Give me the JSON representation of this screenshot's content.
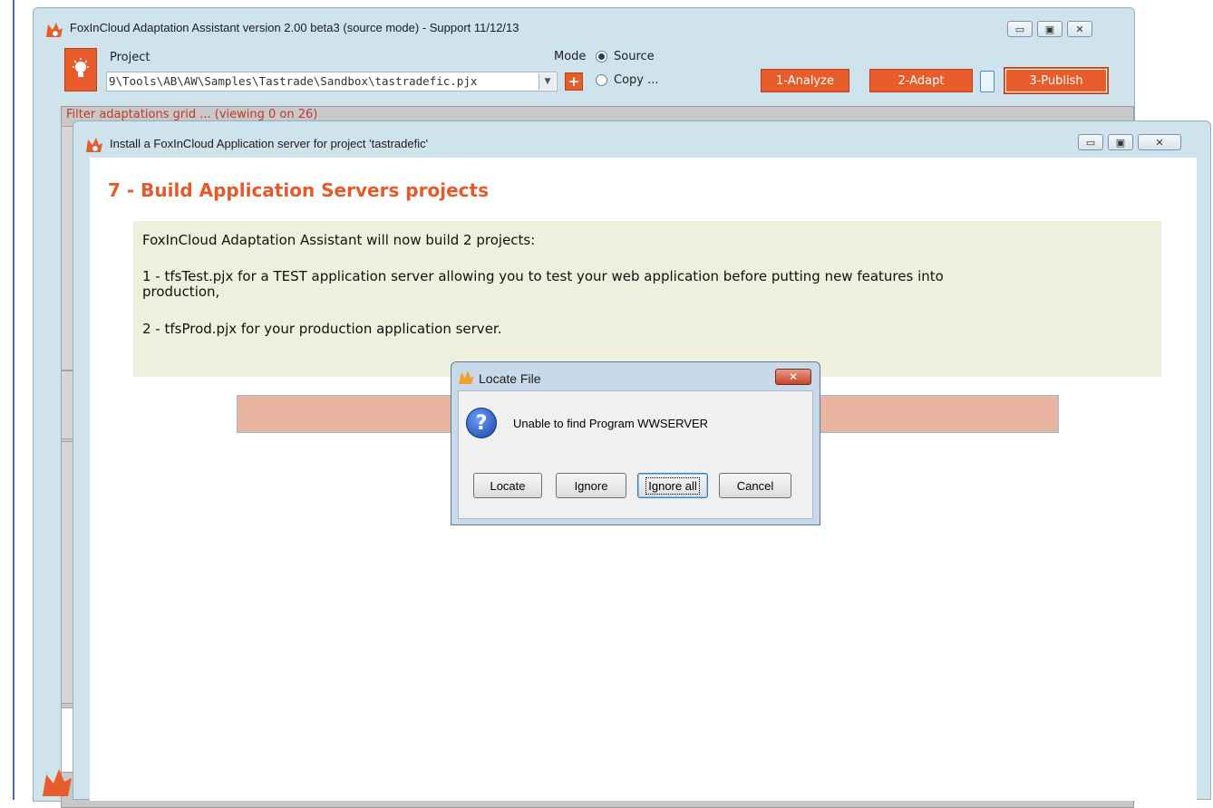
{
  "main_window": {
    "title": "FoxInCloud Adaptation Assistant version 2.00 beta3 (source mode) - Support 11/12/13",
    "project_label": "Project",
    "project_path": "9\\Tools\\AB\\AW\\Samples\\Tastrade\\Sandbox\\tastradefic.pjx",
    "mode_label": "Mode",
    "mode_source": "Source",
    "mode_copy": "Copy ...",
    "plus_label": "+",
    "analyze_button": "1-Analyze",
    "adapt_button": "2-Adapt",
    "publish_button": "3-Publish",
    "filter_text": "Filter adaptations grid ... (viewing 0 on 26)"
  },
  "install_window": {
    "title": "Install a FoxInCloud Application server for project 'tastradefic'",
    "heading": "7 - Build Application Servers projects",
    "info_line1": "FoxInCloud Adaptation Assistant will now build 2 projects:",
    "info_line2a": "1 - tfsTest.pjx for a TEST application server allowing you to test your web application before putting new features into",
    "info_line2b": "production,",
    "info_line3": "2 - tfsProd.pjx for your production application server."
  },
  "locate_dialog": {
    "title": "Locate File",
    "close_glyph": "✕",
    "question_glyph": "?",
    "message": "Unable to find Program WWSERVER",
    "buttons": {
      "locate": "Locate",
      "ignore": "Ignore",
      "ignore_all": "Ignore all",
      "cancel": "Cancel"
    }
  },
  "colors": {
    "accent_orange": "#e65c2b",
    "heading_orange": "#e8592a",
    "filter_red": "#c0392b",
    "window_frame": "#cfe3ec"
  },
  "icons": {
    "app_icon": "fox-icon",
    "bulb": "lightbulb-icon",
    "question": "question-icon"
  }
}
